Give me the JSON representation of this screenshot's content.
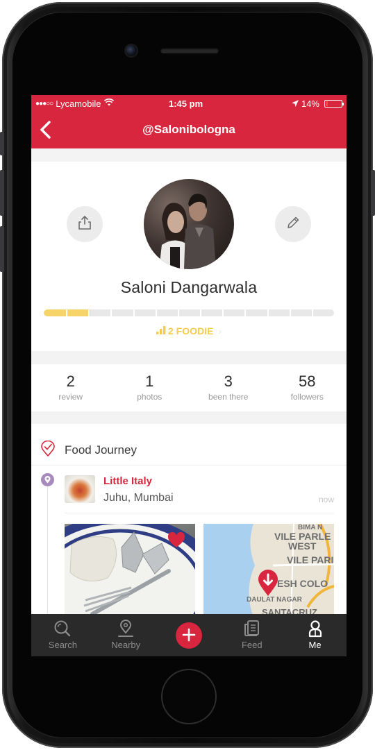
{
  "status_bar": {
    "signal": "●●●○○",
    "carrier": "Lycamobile",
    "time": "1:45 pm",
    "battery_percent": "14%",
    "battery_level": 0.14
  },
  "nav": {
    "title": "@Salonibologna",
    "back_icon": "chevron-left-icon"
  },
  "profile": {
    "name": "Saloni Dangarwala",
    "progress_fraction": 0.16,
    "progress_segments": 13,
    "level_label": "2 FOODIE",
    "share_icon": "share-icon",
    "edit_icon": "pencil-icon"
  },
  "stats": [
    {
      "value": "2",
      "label": "review"
    },
    {
      "value": "1",
      "label": "photos"
    },
    {
      "value": "3",
      "label": "been there"
    },
    {
      "value": "58",
      "label": "followers"
    }
  ],
  "journey": {
    "title": "Food Journey",
    "entry": {
      "restaurant": "Little Italy",
      "location": "Juhu, Mumbai",
      "time": "now"
    },
    "map_labels": [
      "BIMA N",
      "VILE PARLE",
      "WEST",
      "VILE PARI",
      "ESH COLO",
      "DAULAT NAGAR",
      "SANTACRUZ"
    ]
  },
  "tabs": [
    {
      "label": "Search",
      "icon": "search-icon"
    },
    {
      "label": "Nearby",
      "icon": "location-pin-icon"
    },
    {
      "label": "",
      "icon": "plus-icon"
    },
    {
      "label": "Feed",
      "icon": "feed-icon"
    },
    {
      "label": "Me",
      "icon": "user-icon"
    }
  ],
  "colors": {
    "brand_red": "#d7263d",
    "level_yellow": "#f6cc4e",
    "pin_purple": "#a78bbd",
    "tabbar": "#2a2a2a"
  }
}
